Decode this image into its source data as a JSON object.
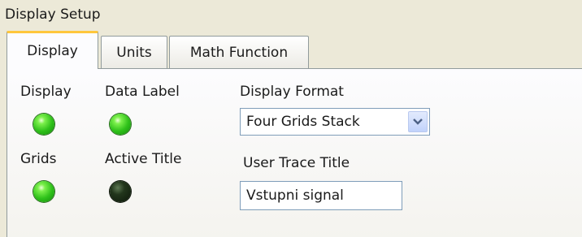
{
  "group": {
    "title": "Display Setup"
  },
  "tabs": [
    {
      "label": "Display",
      "active": true
    },
    {
      "label": "Units",
      "active": false
    },
    {
      "label": "Math Function",
      "active": false
    }
  ],
  "indicators": {
    "display": {
      "label": "Display",
      "state": "on"
    },
    "data_label": {
      "label": "Data Label",
      "state": "on"
    },
    "grids": {
      "label": "Grids",
      "state": "on"
    },
    "active_title": {
      "label": "Active Title",
      "state": "off"
    }
  },
  "display_format": {
    "label": "Display Format",
    "value": "Four Grids Stack",
    "icon": "chevron-down-icon"
  },
  "user_trace_title": {
    "label": "User Trace Title",
    "value": "Vstupni signal"
  },
  "colors": {
    "led_on": "#2fc11a",
    "led_off": "#1a2a15",
    "active_tab_accent": "#ffc73c",
    "input_border": "#7f9db9"
  }
}
